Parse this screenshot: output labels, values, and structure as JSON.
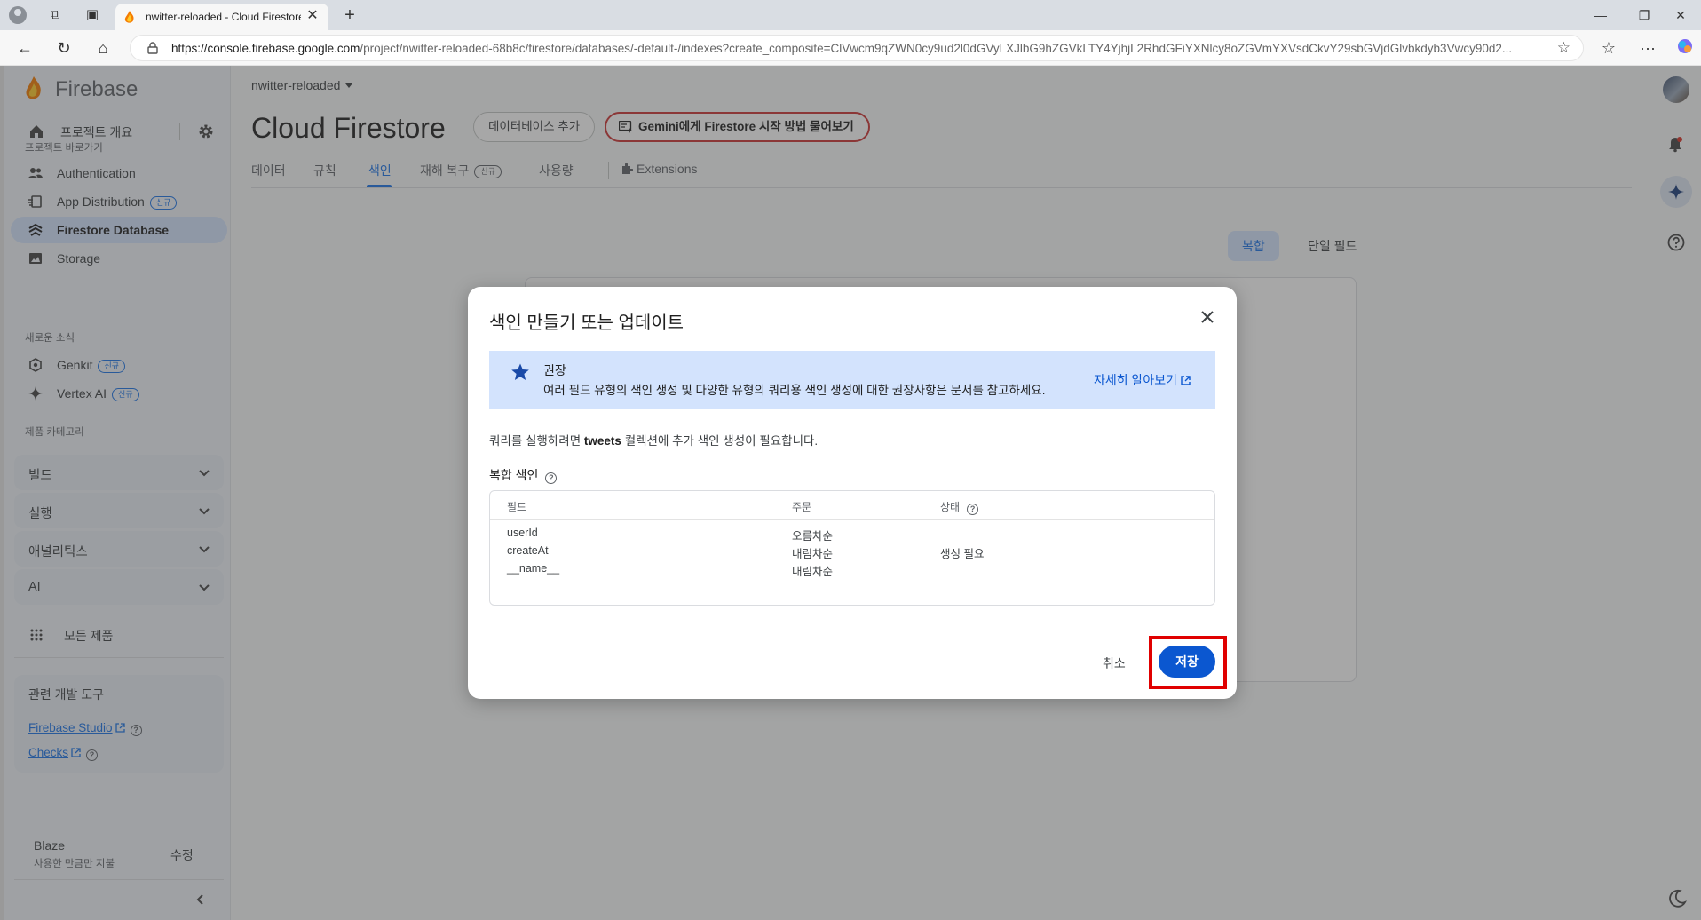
{
  "browser": {
    "tab_title": "nwitter-reloaded - Cloud Firestore",
    "url_host_prefix": "https://console.firebase.google.com",
    "url_path": "/project/nwitter-reloaded-68b8c/firestore/databases/-default-/indexes?create_composite=ClVwcm9qZWN0cy9ud2l0dGVyLXJlbG9hZGVkLTY4YjhjL2RhdGFiYXNlcy8oZGVmYXVsdCkvY29sbGVjdGlvbkdyb3Vwcy90d2..."
  },
  "sidebar": {
    "brand": "Firebase",
    "overview": "프로젝트 개요",
    "shortcuts_title": "프로젝트 바로가기",
    "items": [
      {
        "label": "Authentication",
        "icon": "people-icon"
      },
      {
        "label": "App Distribution",
        "badge": "신규",
        "icon": "app-distribution-icon"
      },
      {
        "label": "Firestore Database",
        "icon": "firestore-icon",
        "active": true
      },
      {
        "label": "Storage",
        "icon": "storage-icon"
      }
    ],
    "news_title": "새로운 소식",
    "news_items": [
      {
        "label": "Genkit",
        "badge": "신규"
      },
      {
        "label": "Vertex AI",
        "badge": "신규"
      }
    ],
    "categories_title": "제품 카테고리",
    "categories": [
      "빌드",
      "실행",
      "애널리틱스",
      "AI"
    ],
    "all_products": "모든 제품",
    "devtools_title": "관련 개발 도구",
    "devtools_links": [
      "Firebase Studio",
      "Checks"
    ],
    "plan_name": "Blaze",
    "plan_desc": "사용한 만큼만 지불",
    "plan_edit": "수정"
  },
  "main": {
    "project": "nwitter-reloaded",
    "title": "Cloud Firestore",
    "add_db": "데이터베이스 추가",
    "gemini_button": "Gemini에게 Firestore 시작 방법 물어보기",
    "tabs": [
      "데이터",
      "규칙",
      "색인",
      "재해 복구",
      "사용량",
      "Extensions"
    ],
    "tab_badge": "신규",
    "active_tab": "색인",
    "segments": [
      "복합",
      "단일 필드"
    ]
  },
  "modal": {
    "title": "색인 만들기 또는 업데이트",
    "reco_title": "권장",
    "reco_desc": "여러 필드 유형의 색인 생성 및 다양한 유형의 쿼리용 색인 생성에 대한 권장사항은 문서를 참고하세요.",
    "reco_link": "자세히 알아보기",
    "note_prefix": "쿼리를 실행하려면",
    "note_collection": "tweets",
    "note_suffix": "컬렉션에 추가 색인 생성이 필요합니다.",
    "subtitle": "복합 색인",
    "columns": [
      "필드",
      "주문",
      "상태"
    ],
    "rows": [
      {
        "field": "userId",
        "order": "오름차순",
        "status": ""
      },
      {
        "field": "createAt",
        "order": "내림차순",
        "status": "생성 필요"
      },
      {
        "field": "__name__",
        "order": "내림차순",
        "status": ""
      }
    ],
    "cancel": "취소",
    "save": "저장"
  },
  "colors": {
    "accent": "#0b57d0",
    "active_nav": "#d3e3fd",
    "highlight": "#e00000"
  }
}
